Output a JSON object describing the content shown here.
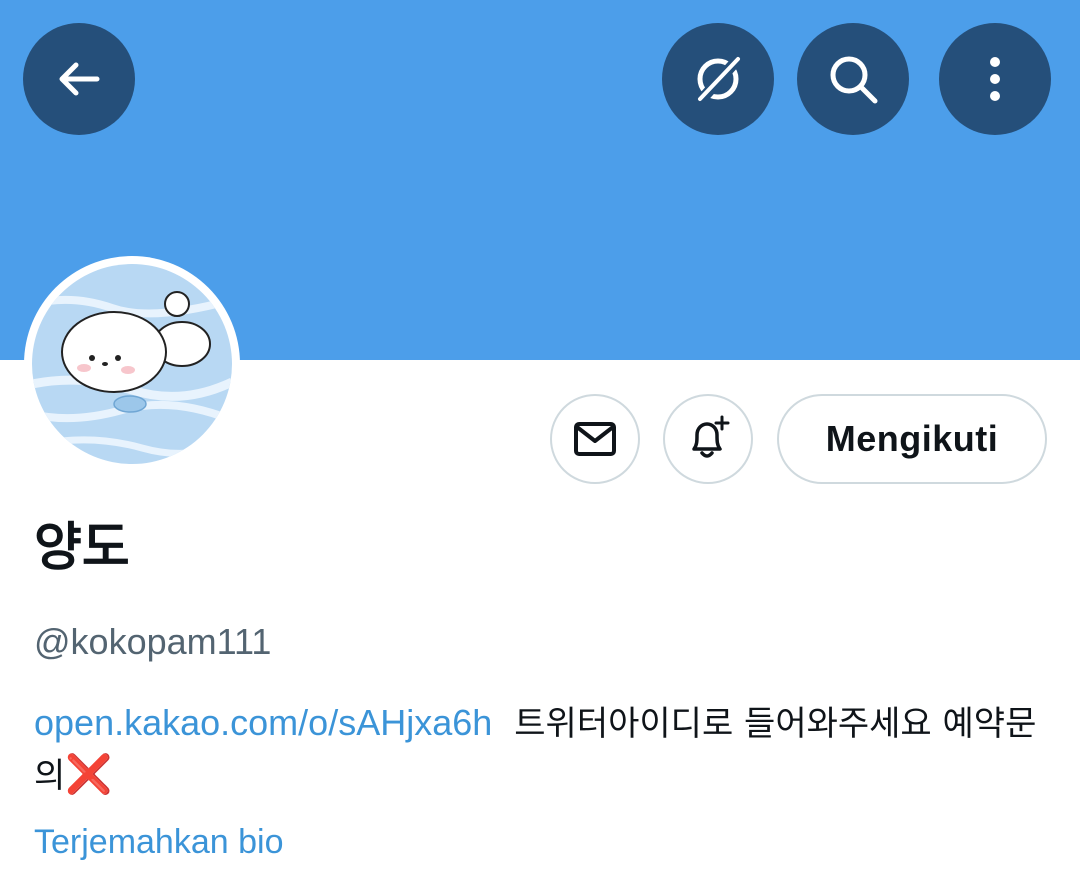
{
  "header": {
    "back_icon": "arrow-left-icon",
    "hide_icon": "eye-slash-icon",
    "search_icon": "search-icon",
    "more_icon": "more-vertical-icon",
    "banner_color": "#4c9eea",
    "button_color": "#254f7a"
  },
  "profile": {
    "avatar_description": "avatar-image",
    "display_name": "양도",
    "handle": "@kokopam111",
    "bio_link": "open.kakao.com/o/sAHjxa6h",
    "bio_text": "트위터아이디로 들어와주세요 예약문의",
    "bio_emoji": "❌",
    "translate_label": "Terjemahkan bio"
  },
  "actions": {
    "message_icon": "envelope-icon",
    "notify_icon": "bell-plus-icon",
    "follow_label": "Mengikuti"
  },
  "colors": {
    "link": "#3b94d8",
    "handle": "#536471",
    "text": "#0f1419",
    "border": "#cfd9de"
  }
}
